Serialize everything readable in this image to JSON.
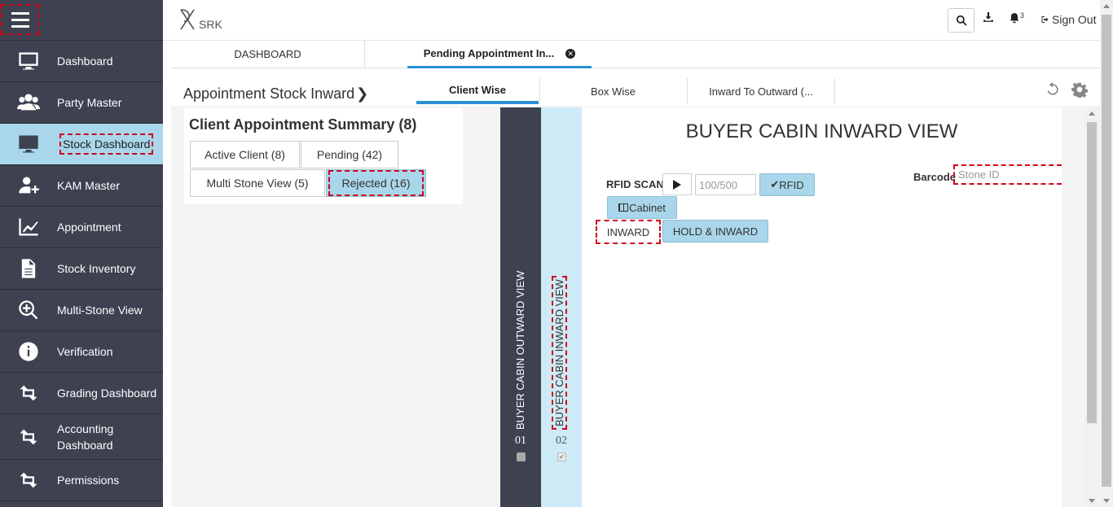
{
  "brand": {
    "logo_text": "SRK"
  },
  "sidebar": {
    "items": [
      {
        "label": "Dashboard",
        "icon": "monitor-icon"
      },
      {
        "label": "Party Master",
        "icon": "users-icon"
      },
      {
        "label": "Stock Dashboard",
        "icon": "monitor-icon",
        "active": true
      },
      {
        "label": "KAM Master",
        "icon": "add-user-icon"
      },
      {
        "label": "Appointment",
        "icon": "line-chart-icon"
      },
      {
        "label": "Stock Inventory",
        "icon": "document-icon"
      },
      {
        "label": "Multi-Stone View",
        "icon": "zoom-in-icon"
      },
      {
        "label": "Verification",
        "icon": "info-icon"
      },
      {
        "label": "Grading Dashboard",
        "icon": "retweet-icon"
      },
      {
        "label": "Accounting Dashboard",
        "icon": "retweet-icon"
      },
      {
        "label": "Permissions",
        "icon": "retweet-icon"
      }
    ],
    "colors": {
      "background": "#3d4150",
      "active": "#a9d6ea"
    }
  },
  "topbar": {
    "notification_count": "3",
    "signout_label": "Sign Out"
  },
  "page_tabs": {
    "dashboard": "DASHBOARD",
    "pending": "Pending Appointment In..."
  },
  "subheader": {
    "title": "Appointment Stock Inward",
    "tabs": {
      "client_wise": "Client Wise",
      "box_wise": "Box Wise",
      "inward_to_outward": "Inward To Outward (..."
    }
  },
  "summary": {
    "title": "Client Appointment Summary (8)",
    "buttons": {
      "active_client": "Active Client (8)",
      "pending": "Pending (42)",
      "multi_stone": "Multi Stone View (5)",
      "rejected": "Rejected (16)"
    }
  },
  "vertical_panels": {
    "outward": {
      "label": "BUYER CABIN OUTWARD VIEW",
      "number": "01",
      "checked": false
    },
    "inward": {
      "label": "BUYER CABIN INWARD VIEW",
      "number": "02",
      "checked": true
    }
  },
  "inward_view": {
    "heading": "BUYER CABIN INWARD VIEW",
    "rfid_scan_label": "RFID SCAN",
    "count_placeholder": "100/500",
    "rfid_button": "RFID",
    "cabinet_button": "Cabinet",
    "inward_button": "INWARD",
    "hold_inward_button": "HOLD & INWARD",
    "barcode_label": "Barcode",
    "barcode_placeholder": "Stone ID"
  },
  "colors": {
    "accent": "#2b8fd6",
    "highlight_button": "#a9d6ea"
  }
}
